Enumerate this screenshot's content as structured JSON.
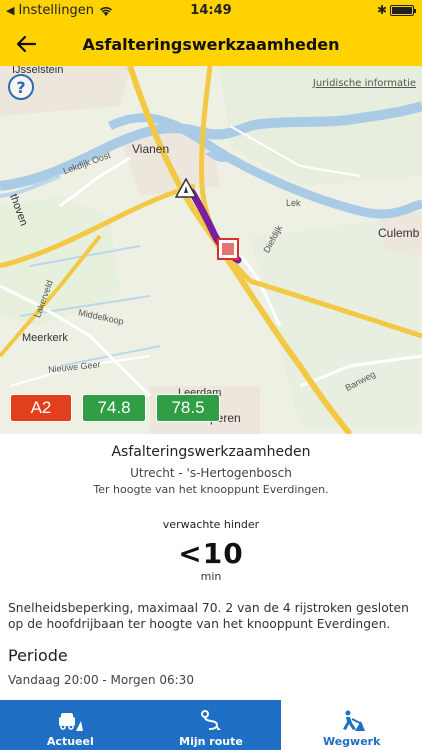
{
  "status": {
    "carrier": "Instellingen",
    "time": "14:49",
    "bluetooth": "✱"
  },
  "header": {
    "title": "Asfalteringswerkzaamheden"
  },
  "map": {
    "legal": "Juridische informatie",
    "places": {
      "ijsselstein": "IJsselstein",
      "vianen": "Vianen",
      "culemborg": "Culemb",
      "meerkerk": "Meerkerk",
      "leerdam": "Leerdam",
      "hoven": "thoven",
      "perenl": "peren"
    },
    "roads": {
      "lekdijk": "Lekdijk Oost",
      "lek": "Lek",
      "diefdijk": "Diefdijk",
      "lakerveld": "Lakerveld",
      "middelkoop": "Middelkoop",
      "nieuwegeer": "Nieuwe Geer",
      "banweg": "Banweg"
    },
    "badges": {
      "road": "A2",
      "km_start": "74.8",
      "km_end": "78.5"
    },
    "colors": {
      "road_badge": "#e2401c",
      "km_badge": "#2f9e44",
      "route": "#7b1fa2"
    }
  },
  "details": {
    "title": "Asfalteringswerkzaamheden",
    "route": "Utrecht - 's-Hertogenbosch",
    "location": "Ter hoogte van het knooppunt Everdingen.",
    "hinder_label": "verwachte hinder",
    "hinder_value": "<10",
    "hinder_unit": "min",
    "description": "Snelheidsbeperking, maximaal 70. 2 van de 4 rijstroken gesloten op de hoofdrijbaan ter hoogte van het knooppunt Everdingen.",
    "periode_label": "Periode",
    "periode_value": "Vandaag 20:00 - Morgen 06:30"
  },
  "tabs": [
    {
      "label": "Actueel",
      "icon": "traffic-icon"
    },
    {
      "label": "Mijn route",
      "icon": "route-icon"
    },
    {
      "label": "Wegwerk",
      "icon": "roadwork-icon"
    }
  ]
}
